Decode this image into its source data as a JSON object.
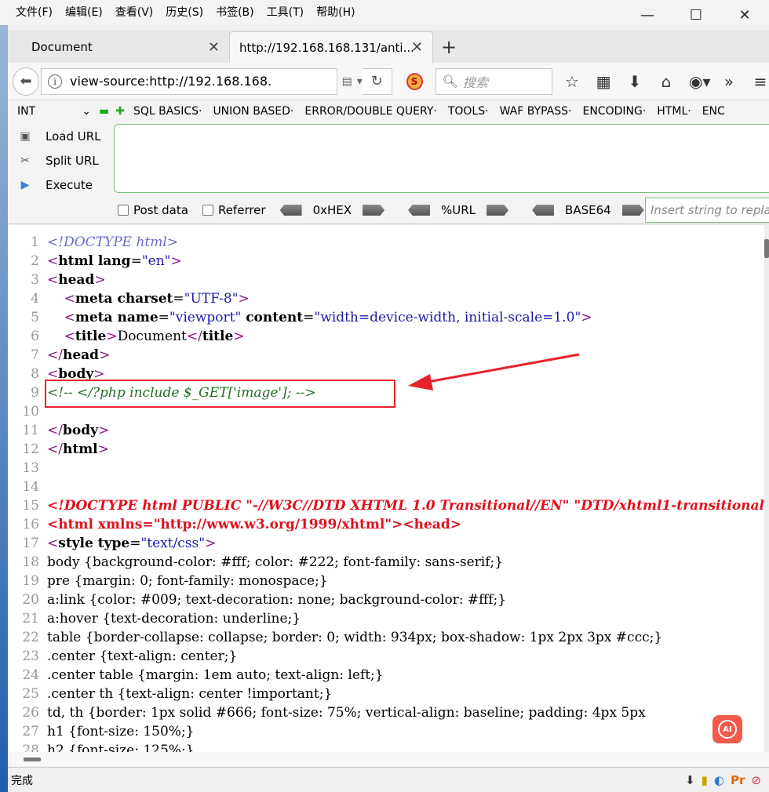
{
  "menubar": {
    "items": [
      "文件(F)",
      "编辑(E)",
      "查看(V)",
      "历史(S)",
      "书签(B)",
      "工具(T)",
      "帮助(H)"
    ]
  },
  "window_controls": {
    "minimize": "—",
    "maximize": "☐",
    "close": "✕"
  },
  "tabs": [
    {
      "label": "Document",
      "active": false
    },
    {
      "label": "http://192.168.168.131/anti...",
      "active": true
    }
  ],
  "navbar": {
    "url": "view-source:http://192.168.168.",
    "search_placeholder": "搜索",
    "icons": [
      "star-icon",
      "reading-list-icon",
      "download-icon",
      "home-icon",
      "globe-icon",
      "overflow-icon",
      "hamburger-icon"
    ]
  },
  "hackbar": {
    "select_value": "INT",
    "menu": [
      "SQL BASICS·",
      "UNION BASED·",
      "ERROR/DOUBLE QUERY·",
      "TOOLS·",
      "WAF BYPASS·",
      "ENCODING·",
      "HTML·",
      "ENC"
    ],
    "actions": [
      "Load URL",
      "Split URL",
      "Execute"
    ],
    "post_data_label": "Post data",
    "referrer_label": "Referrer",
    "encoders": [
      "0xHEX",
      "%URL",
      "BASE64"
    ],
    "insert_placeholder": "Insert string to replac"
  },
  "source_lines": [
    {
      "n": "1"
    },
    {
      "n": "2"
    },
    {
      "n": "3"
    },
    {
      "n": "4"
    },
    {
      "n": "5"
    },
    {
      "n": "6"
    },
    {
      "n": "7"
    },
    {
      "n": "8"
    },
    {
      "n": "9"
    },
    {
      "n": "10"
    },
    {
      "n": "11"
    },
    {
      "n": "12"
    },
    {
      "n": "13"
    },
    {
      "n": "14"
    },
    {
      "n": "15"
    },
    {
      "n": "16"
    },
    {
      "n": "17"
    },
    {
      "n": "18"
    },
    {
      "n": "19"
    },
    {
      "n": "20"
    },
    {
      "n": "21"
    },
    {
      "n": "22"
    },
    {
      "n": "23"
    },
    {
      "n": "24"
    },
    {
      "n": "25"
    },
    {
      "n": "26"
    },
    {
      "n": "27"
    },
    {
      "n": "28"
    }
  ],
  "source": {
    "l1": "<!DOCTYPE html>",
    "l2_open": "<",
    "l2_tag": "html",
    "l2_attr": " lang",
    "l2_eq": "=",
    "l2_val": "\"en\"",
    "l2_close": ">",
    "l3": "head",
    "l4_tag": "meta",
    "l4_attr": " charset",
    "l4_val": "\"UTF-8\"",
    "l5_tag": "meta",
    "l5_attr1": " name",
    "l5_val1": "\"viewport\"",
    "l5_attr2": " content",
    "l5_val2": "\"width=device-width, initial-scale=1.0\"",
    "l6_tag": "title",
    "l6_text": "Document",
    "l7": "head",
    "l8": "body",
    "l9": "<!-- </?php include $_GET['image']; -->",
    "l11": "body",
    "l12": "html",
    "l15": "<!DOCTYPE html PUBLIC \"-//W3C//DTD XHTML 1.0 Transitional//EN\" \"DTD/xhtml1-transitional",
    "l16_a": "<html xmlns=",
    "l16_v": "\"http://www.w3.org/1999/xhtml\"",
    "l16_b": "><head>",
    "l17_tag": "style",
    "l17_attr": " type",
    "l17_val": "\"text/css\"",
    "l18": "body {background-color: #fff; color: #222; font-family: sans-serif;}",
    "l19": "pre {margin: 0; font-family: monospace;}",
    "l20": "a:link {color: #009; text-decoration: none; background-color: #fff;}",
    "l21": "a:hover {text-decoration: underline;}",
    "l22": "table {border-collapse: collapse; border: 0; width: 934px; box-shadow: 1px 2px 3px #ccc;}",
    "l23": ".center {text-align: center;}",
    "l24": ".center table {margin: 1em auto; text-align: left;}",
    "l25": ".center th {text-align: center !important;}",
    "l26": "td, th {border: 1px solid #666; font-size: 75%; vertical-align: baseline; padding: 4px 5px",
    "l27": "h1 {font-size: 150%;}",
    "l28": "h2 {font-size: 125%;}"
  },
  "ai_badge": "AI",
  "status": {
    "text": "完成"
  }
}
